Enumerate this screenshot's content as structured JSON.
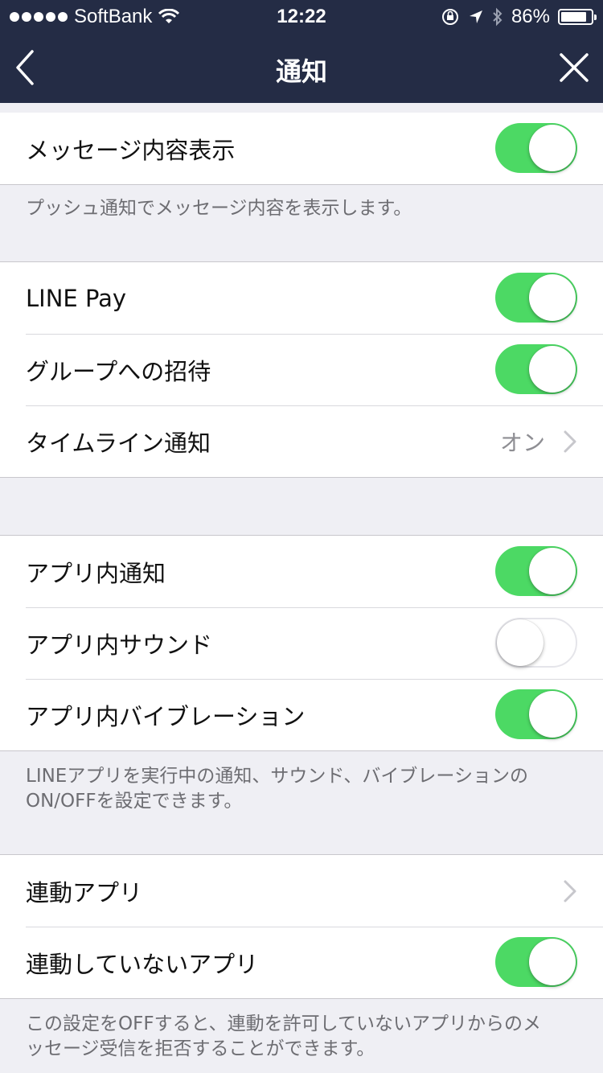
{
  "status_bar": {
    "carrier": "SoftBank",
    "time": "12:22",
    "battery": "86%",
    "battery_level": 0.86
  },
  "nav": {
    "title": "通知",
    "back_icon": "chevron-left-icon",
    "close_icon": "close-icon"
  },
  "sections": {
    "message": {
      "rows": [
        {
          "label": "メッセージ内容表示",
          "toggle": "on"
        }
      ],
      "footnote": "プッシュ通知でメッセージ内容を表示します。"
    },
    "notifications": {
      "rows": [
        {
          "label": "LINE Pay",
          "toggle": "on"
        },
        {
          "label": "グループへの招待",
          "toggle": "on"
        },
        {
          "label": "タイムライン通知",
          "value": "オン"
        }
      ]
    },
    "in_app": {
      "rows": [
        {
          "label": "アプリ内通知",
          "toggle": "on"
        },
        {
          "label": "アプリ内サウンド",
          "toggle": "off"
        },
        {
          "label": "アプリ内バイブレーション",
          "toggle": "on"
        }
      ],
      "footnote_line1": "LINEアプリを実行中の通知、サウンド、バイブレーションの",
      "footnote_line2": "ON/OFFを設定できます。"
    },
    "linked": {
      "rows": [
        {
          "label": "連動アプリ"
        },
        {
          "label": "連動していないアプリ",
          "toggle": "on"
        }
      ],
      "footnote_line1": "この設定をOFFすると、連動を許可していないアプリからのメ",
      "footnote_line2": "ッセージ受信を拒否することができます。"
    }
  },
  "colors": {
    "nav_bg": "#242c45",
    "toggle_on": "#4cd964",
    "background": "#efeff4"
  }
}
